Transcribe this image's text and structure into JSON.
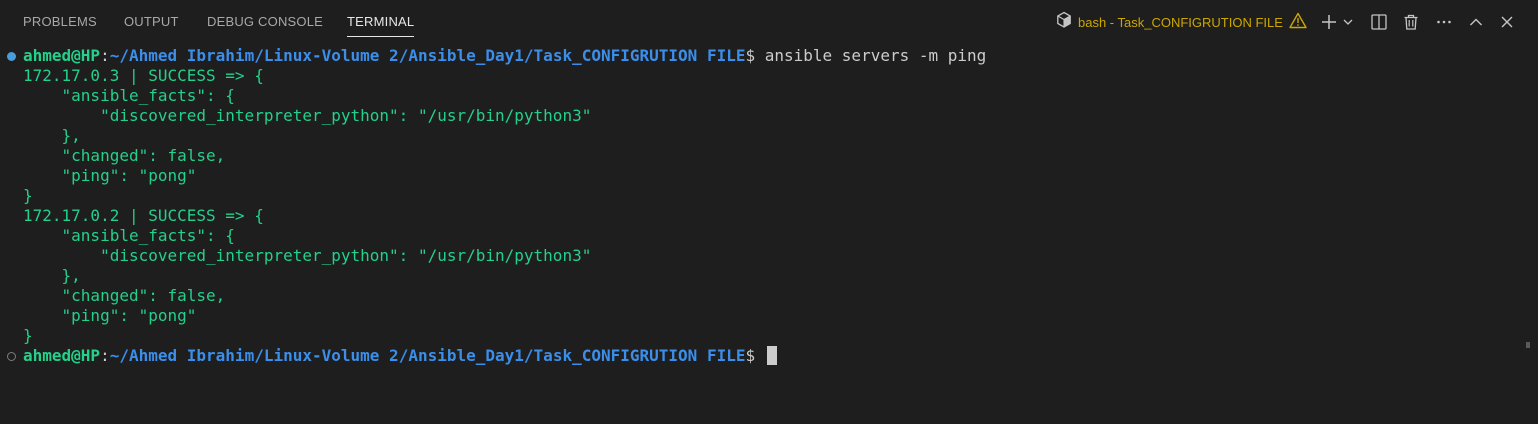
{
  "tabs": [
    {
      "label": "PROBLEMS",
      "active": false
    },
    {
      "label": "OUTPUT",
      "active": false
    },
    {
      "label": "DEBUG CONSOLE",
      "active": false
    },
    {
      "label": "TERMINAL",
      "active": true
    }
  ],
  "terminal_profile": {
    "label": "bash - Task_CONFIGRUTION FILE",
    "icon": "terminal-cube-icon",
    "warning_icon": "warning-icon",
    "warning_color": "#cca700"
  },
  "toolbar": {
    "icons": [
      "plus-icon",
      "chevron-down-icon",
      "split-editor-icon",
      "trash-icon",
      "ellipsis-icon",
      "chevron-up-icon",
      "close-icon"
    ]
  },
  "prompt": {
    "user": "ahmed@HP",
    "separator": ":",
    "path": "~/Ahmed Ibrahim/Linux-Volume 2/Ansible_Day1/Task_CONFIGRUTION FILE",
    "symbol": "$ ",
    "command": "ansible servers -m ping"
  },
  "output": [
    "172.17.0.3 | SUCCESS => {",
    "    \"ansible_facts\": {",
    "        \"discovered_interpreter_python\": \"/usr/bin/python3\"",
    "    },",
    "    \"changed\": false,",
    "    \"ping\": \"pong\"",
    "}",
    "172.17.0.2 | SUCCESS => {",
    "    \"ansible_facts\": {",
    "        \"discovered_interpreter_python\": \"/usr/bin/python3\"",
    "    },",
    "    \"changed\": false,",
    "    \"ping\": \"pong\"",
    "}"
  ],
  "colors": {
    "background": "#1e1e1e",
    "prompt_user": "#23d18b",
    "prompt_path": "#3b8eea",
    "output_text": "#23d18b",
    "tab_active": "#e7e7e7",
    "tab_inactive": "#a8a8a8"
  }
}
